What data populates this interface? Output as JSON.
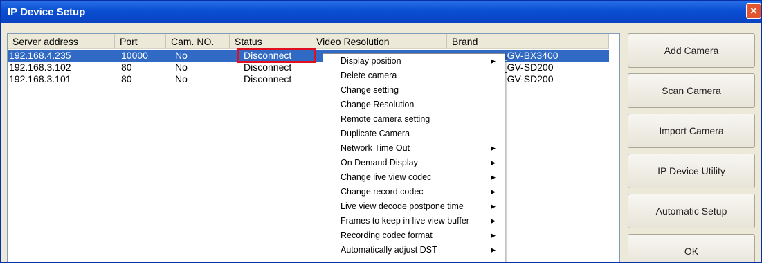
{
  "window": {
    "title": "IP Device Setup",
    "close_label": "×"
  },
  "table": {
    "headers": [
      "Server address",
      "Port",
      "Cam. NO.",
      "Status",
      "Video Resolution",
      "Brand"
    ],
    "rows": [
      {
        "server": "192.168.4.235",
        "port": "10000",
        "cam": "No",
        "status": "Disconnect",
        "brand": "n_GV-BX3400",
        "selected": true
      },
      {
        "server": "192.168.3.102",
        "port": "80",
        "cam": "No",
        "status": "Disconnect",
        "brand": "n_GV-SD200",
        "selected": false
      },
      {
        "server": "192.168.3.101",
        "port": "80",
        "cam": "No",
        "status": "Disconnect",
        "brand": "n_GV-SD200",
        "selected": false
      }
    ]
  },
  "context_menu": {
    "items": [
      {
        "label": "Display position",
        "submenu": true
      },
      {
        "label": "Delete camera",
        "submenu": false
      },
      {
        "label": "Change setting",
        "submenu": false
      },
      {
        "label": "Change Resolution",
        "submenu": false
      },
      {
        "label": "Remote camera setting",
        "submenu": false
      },
      {
        "label": "Duplicate Camera",
        "submenu": false
      },
      {
        "label": "Network Time Out",
        "submenu": true
      },
      {
        "label": "On Demand Display",
        "submenu": true
      },
      {
        "label": "Change live view codec",
        "submenu": true
      },
      {
        "label": "Change record codec",
        "submenu": true
      },
      {
        "label": "Live view decode postpone time",
        "submenu": true
      },
      {
        "label": "Frames to keep in live view buffer",
        "submenu": true
      },
      {
        "label": "Recording codec format",
        "submenu": true
      },
      {
        "label": "Automatically adjust DST",
        "submenu": true
      }
    ]
  },
  "buttons": {
    "add_camera": "Add Camera",
    "scan_camera": "Scan Camera",
    "import_camera": "Import Camera",
    "ip_device_utility": "IP Device Utility",
    "automatic_setup": "Automatic Setup",
    "ok": "OK"
  },
  "colors": {
    "title_bar": "#0a4fd3",
    "selection": "#316ac5",
    "highlight_box": "#e01020",
    "close_button": "#e2562f"
  }
}
